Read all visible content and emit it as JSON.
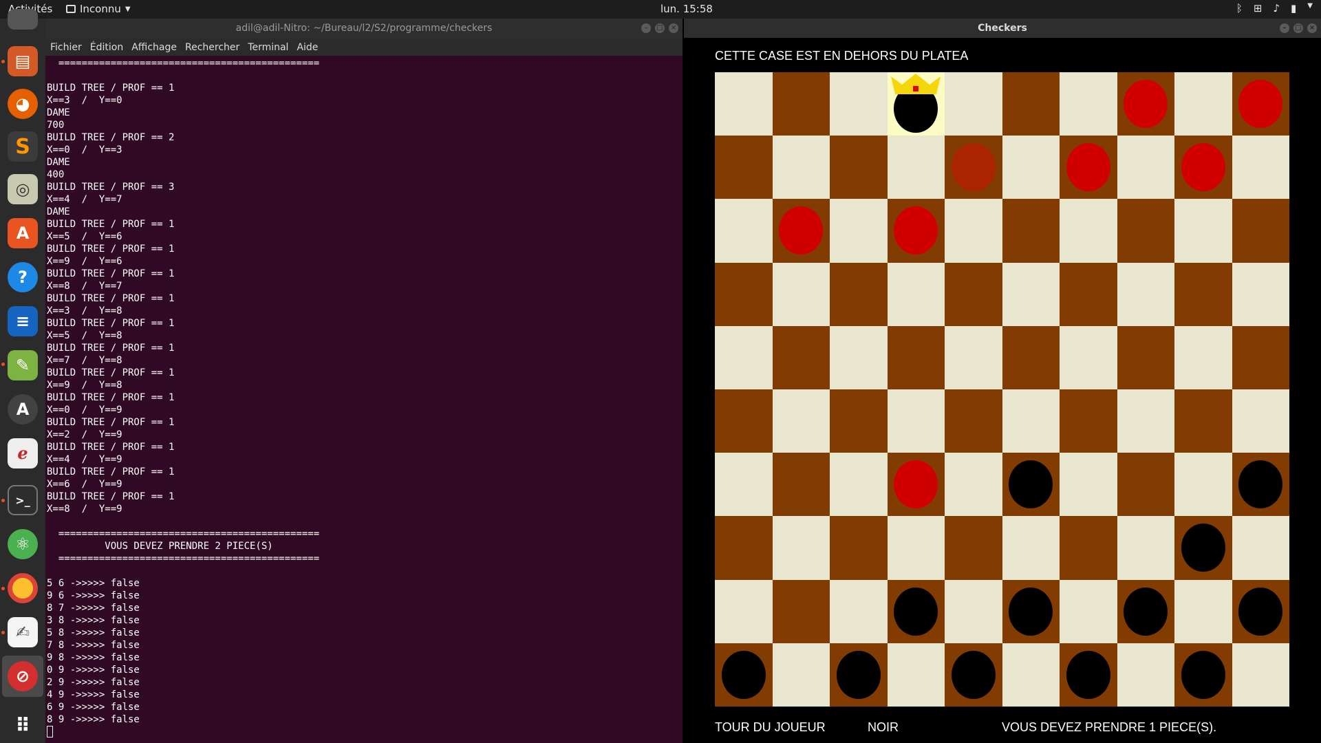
{
  "topbar": {
    "activities": "Activités",
    "app_menu": "Inconnu",
    "clock": "lun. 15:58",
    "tray_icons": [
      "bluetooth-icon",
      "network-icon",
      "volume-icon",
      "battery-icon",
      "menu-arrow-icon"
    ]
  },
  "dock": {
    "items": [
      "files-icon",
      "firefox-icon",
      "sublime-text-icon",
      "rhythmbox-icon",
      "software-center-icon",
      "help-icon",
      "libreoffice-writer-icon",
      "draw-icon",
      "software-updater-icon",
      "document-viewer-icon",
      "terminal-icon",
      "atom-icon",
      "chrome-icon",
      "text-editor-icon",
      "checkers-app-icon",
      "show-apps-icon"
    ]
  },
  "terminal": {
    "title": "adil@adil-Nitro: ~/Bureau/l2/S2/programme/checkers",
    "menu": [
      "Fichier",
      "Édition",
      "Affichage",
      "Rechercher",
      "Terminal",
      "Aide"
    ],
    "output": "  =============================================\n\nBUILD TREE / PROF == 1\nX==3  /  Y==0\nDAME\n700\nBUILD TREE / PROF == 2\nX==0  /  Y==3\nDAME\n400\nBUILD TREE / PROF == 3\nX==4  /  Y==7\nDAME\nBUILD TREE / PROF == 1\nX==5  /  Y==6\nBUILD TREE / PROF == 1\nX==9  /  Y==6\nBUILD TREE / PROF == 1\nX==8  /  Y==7\nBUILD TREE / PROF == 1\nX==3  /  Y==8\nBUILD TREE / PROF == 1\nX==5  /  Y==8\nBUILD TREE / PROF == 1\nX==7  /  Y==8\nBUILD TREE / PROF == 1\nX==9  /  Y==8\nBUILD TREE / PROF == 1\nX==0  /  Y==9\nBUILD TREE / PROF == 1\nX==2  /  Y==9\nBUILD TREE / PROF == 1\nX==4  /  Y==9\nBUILD TREE / PROF == 1\nX==6  /  Y==9\nBUILD TREE / PROF == 1\nX==8  /  Y==9\n\n  =============================================\n          VOUS DEVEZ PRENDRE 2 PIECE(S)\n  =============================================\n\n5 6 ->>>>> false\n9 6 ->>>>> false\n8 7 ->>>>> false\n3 8 ->>>>> false\n5 8 ->>>>> false\n7 8 ->>>>> false\n9 8 ->>>>> false\n0 9 ->>>>> false\n2 9 ->>>>> false\n4 9 ->>>>> false\n6 9 ->>>>> false\n8 9 ->>>>> false\n"
  },
  "checkers": {
    "title": "Checkers",
    "message": "CETTE CASE EST EN DEHORS DU PLATEA",
    "status_turn_label": "TOUR DU JOUEUR",
    "status_player": "NOIR",
    "status_capture": "VOUS DEVEZ PRENDRE 1 PIECE(S).",
    "colors": {
      "light": "#e8e6cf",
      "dark": "#823b00",
      "red": "#d10000",
      "black": "#000000",
      "highlight": "#fdfbc4",
      "crown": "#f5d60a"
    },
    "board": [
      [
        "",
        "",
        "",
        "BK",
        "",
        "",
        "",
        "R",
        "",
        "R"
      ],
      [
        "",
        "",
        "",
        "",
        "DR",
        "",
        "R",
        "",
        "R",
        ""
      ],
      [
        "",
        "R",
        "",
        "R",
        "",
        "",
        "",
        "",
        "",
        ""
      ],
      [
        "",
        "",
        "",
        "",
        "",
        "",
        "",
        "",
        "",
        ""
      ],
      [
        "",
        "",
        "",
        "",
        "",
        "",
        "",
        "",
        "",
        ""
      ],
      [
        "",
        "",
        "",
        "",
        "",
        "",
        "",
        "",
        "",
        ""
      ],
      [
        "",
        "",
        "",
        "R",
        "",
        "B",
        "",
        "",
        "",
        "B"
      ],
      [
        "",
        "",
        "",
        "",
        "",
        "",
        "",
        "",
        "B",
        ""
      ],
      [
        "",
        "",
        "",
        "B",
        "",
        "B",
        "",
        "B",
        "",
        "B"
      ],
      [
        "B",
        "",
        "B",
        "",
        "B",
        "",
        "B",
        "",
        "B",
        ""
      ]
    ],
    "highlighted_cell": [
      0,
      3
    ]
  }
}
